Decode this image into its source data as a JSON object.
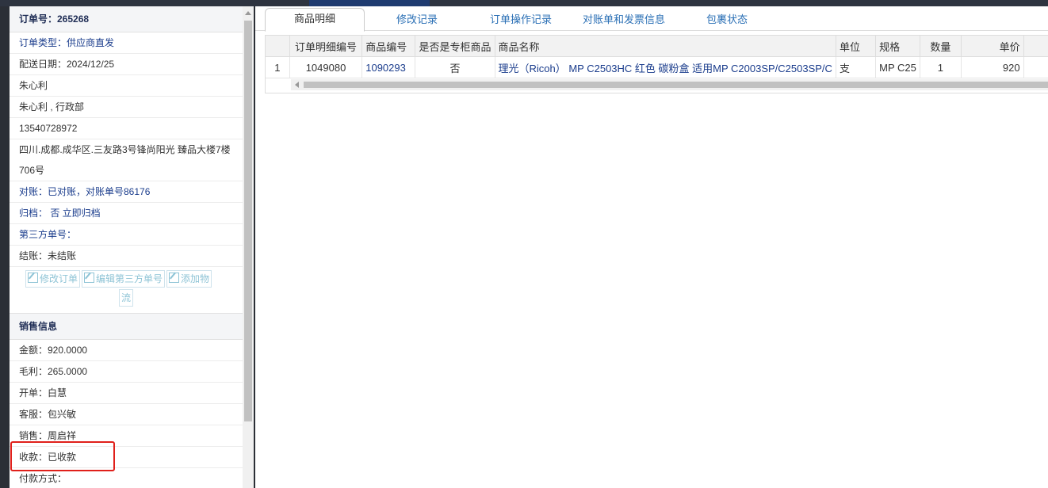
{
  "order": {
    "header": "订单号：265268",
    "rows": [
      {
        "text": "订单类型：供应商直发",
        "style": "blue"
      },
      {
        "text": "配送日期：2024/12/25",
        "style": ""
      },
      {
        "text": "朱心利",
        "style": ""
      },
      {
        "text": "朱心利 , 行政部",
        "style": ""
      },
      {
        "text": "13540728972",
        "style": ""
      }
    ],
    "address": "四川.成都.成华区.三友路3号锋尚阳光 臻品大楼7楼706号",
    "reconcile": "对账：已对账，对账单号86176",
    "archive": "归档： 否 立即归档",
    "third_party_no": "第三方单号：",
    "settlement": "结账：未结账",
    "actions": {
      "edit_order": "修改订单",
      "edit_third_party": "编辑第三方单号",
      "add_logistics_1": "添加物",
      "add_logistics_2": "流"
    }
  },
  "sales": {
    "header": "销售信息",
    "amount": "金额：920.0000",
    "gross_profit": "毛利：265.0000",
    "issuer": "开单：白慧",
    "customer_service": "客服：包兴敏",
    "salesperson": "销售：周启祥",
    "collection": "收款：已收款",
    "payment_method": "付款方式："
  },
  "tabs": [
    "商品明细",
    "修改记录",
    "订单操作记录",
    "对账单和发票信息",
    "包裹状态"
  ],
  "table": {
    "headers": [
      "",
      "订单明细编号",
      "商品编号",
      "是否是专柜商品",
      "商品名称",
      "单位",
      "规格",
      "数量",
      "单价"
    ],
    "row": {
      "index": "1",
      "detail_id": "1049080",
      "product_id": "1090293",
      "is_counter": "否",
      "name": "理光（Ricoh） MP C2503HC 红色 碳粉盒 适用MP C2003SP/C2503SP/C",
      "unit": "支",
      "spec": "MP C25",
      "qty": "1",
      "price": "920"
    }
  }
}
